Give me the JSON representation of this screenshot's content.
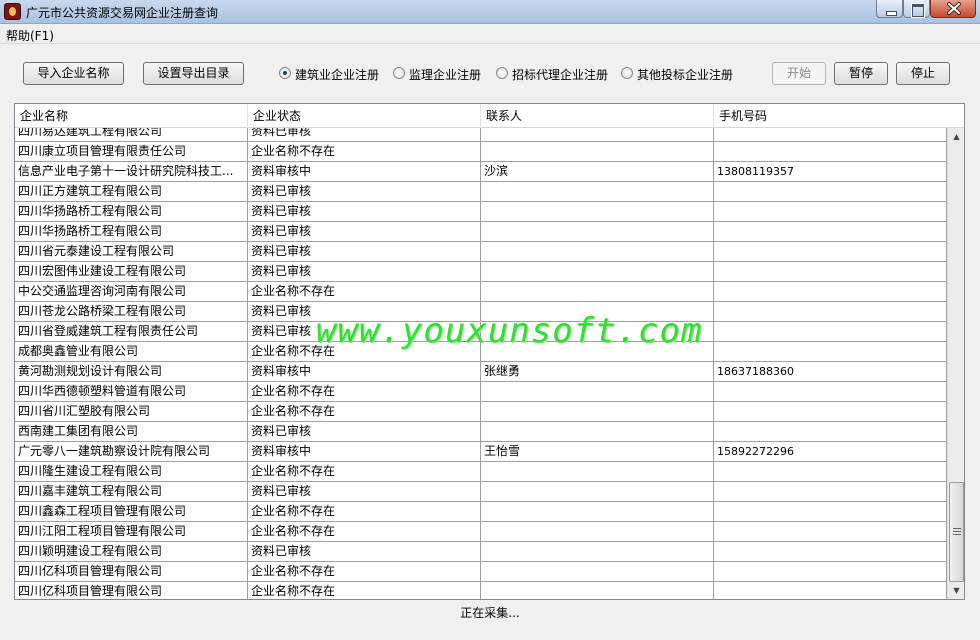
{
  "window": {
    "title": "广元市公共资源交易网企业注册查询"
  },
  "menu": {
    "help": "帮助(F1)"
  },
  "toolbar": {
    "import_names": "导入企业名称",
    "set_export_dir": "设置导出目录",
    "start": "开始",
    "pause": "暂停",
    "stop": "停止"
  },
  "radios": [
    {
      "label": "建筑业企业注册",
      "checked": true
    },
    {
      "label": "监理企业注册",
      "checked": false
    },
    {
      "label": "招标代理企业注册",
      "checked": false
    },
    {
      "label": "其他投标企业注册",
      "checked": false
    }
  ],
  "table": {
    "columns": [
      "企业名称",
      "企业状态",
      "联系人",
      "手机号码"
    ],
    "rows": [
      [
        "四川易达建筑工程有限公司",
        "资料已审核",
        "",
        ""
      ],
      [
        "四川康立项目管理有限责任公司",
        "企业名称不存在",
        "",
        ""
      ],
      [
        "信息产业电子第十一设计研究院科技工...",
        "资料审核中",
        "沙滨",
        "13808119357"
      ],
      [
        "四川正方建筑工程有限公司",
        "资料已审核",
        "",
        ""
      ],
      [
        "四川华扬路桥工程有限公司",
        "资料已审核",
        "",
        ""
      ],
      [
        "四川华扬路桥工程有限公司",
        "资料已审核",
        "",
        ""
      ],
      [
        "四川省元泰建设工程有限公司",
        "资料已审核",
        "",
        ""
      ],
      [
        "四川宏图伟业建设工程有限公司",
        "资料已审核",
        "",
        ""
      ],
      [
        "中公交通监理咨询河南有限公司",
        "企业名称不存在",
        "",
        ""
      ],
      [
        "四川苍龙公路桥梁工程有限公司",
        "资料已审核",
        "",
        ""
      ],
      [
        "四川省登威建筑工程有限责任公司",
        "资料已审核",
        "",
        ""
      ],
      [
        "成都奥鑫管业有限公司",
        "企业名称不存在",
        "",
        ""
      ],
      [
        "黄河勘测规划设计有限公司",
        "资料审核中",
        "张继勇",
        "18637188360"
      ],
      [
        "四川华西德顿塑料管道有限公司",
        "企业名称不存在",
        "",
        ""
      ],
      [
        "四川省川汇塑胶有限公司",
        "企业名称不存在",
        "",
        ""
      ],
      [
        "西南建工集团有限公司",
        "资料已审核",
        "",
        ""
      ],
      [
        "广元零八一建筑勘察设计院有限公司",
        "资料审核中",
        "王怡雪",
        "15892272296"
      ],
      [
        "四川隆生建设工程有限公司",
        "企业名称不存在",
        "",
        ""
      ],
      [
        "四川嘉丰建筑工程有限公司",
        "资料已审核",
        "",
        ""
      ],
      [
        "四川鑫森工程项目管理有限公司",
        "企业名称不存在",
        "",
        ""
      ],
      [
        "四川江阳工程项目管理有限公司",
        "企业名称不存在",
        "",
        ""
      ],
      [
        "四川颖明建设工程有限公司",
        "资料已审核",
        "",
        ""
      ],
      [
        "四川亿科项目管理有限公司",
        "企业名称不存在",
        "",
        ""
      ],
      [
        "四川亿科项目管理有限公司",
        "企业名称不存在",
        "",
        ""
      ]
    ]
  },
  "watermark": "www.youxunsoft.com",
  "status": "正在采集..."
}
